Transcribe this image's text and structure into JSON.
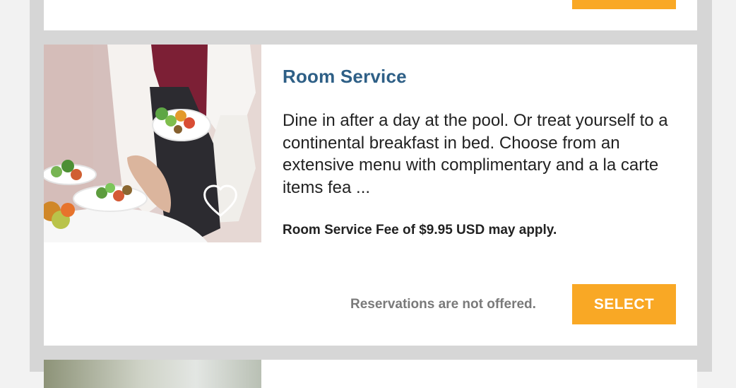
{
  "listing": {
    "title": "Room Service",
    "description": "Dine in after a day at the pool. Or treat yourself to a continental breakfast in bed. Choose from an extensive menu with complimentary and a la carte items fea ...",
    "fee_note": "Room Service Fee of $9.95 USD may apply.",
    "reservation_note": "Reservations are not offered.",
    "select_label": "SELECT",
    "image_alt": "Waiter serving plated food",
    "favorite_icon": "heart-icon"
  },
  "colors": {
    "accent_button": "#f9a825",
    "title": "#2e5f86",
    "page_background": "#f2f2f2",
    "frame_background": "#d6d6d6",
    "card_background": "#ffffff"
  }
}
